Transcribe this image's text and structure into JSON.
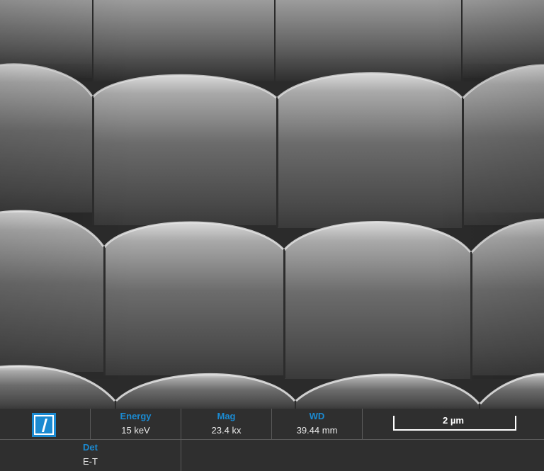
{
  "image": {
    "subject": "microlens-array",
    "palette": {
      "cap_light": "#c4c4c4",
      "cap_dark": "#4a4a4a",
      "gap": "#2a2a2a",
      "edge": "#dcdcdc"
    }
  },
  "databar": {
    "logo_icon": "microscope-logo-icon",
    "energy": {
      "label": "Energy",
      "value": "15 keV"
    },
    "mag": {
      "label": "Mag",
      "value": "23.4 kx"
    },
    "wd": {
      "label": "WD",
      "value": "39.44 mm"
    },
    "scale_bar": {
      "label": "2 µm"
    },
    "det": {
      "label": "Det",
      "value": "E-T"
    }
  }
}
